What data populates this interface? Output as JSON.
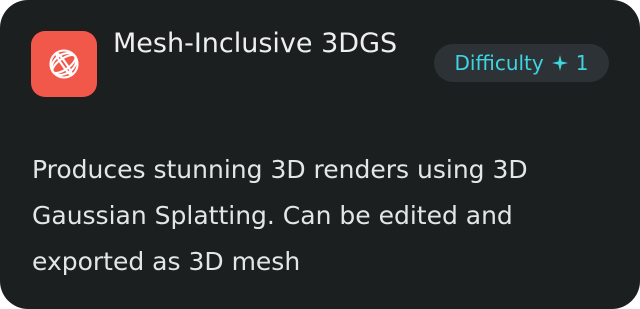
{
  "card": {
    "title": "Mesh-Inclusive 3DGS",
    "logo_icon": "sphere-wireframe-icon",
    "badge": {
      "label": "Difficulty",
      "icon": "sparkle-icon",
      "value": "1"
    },
    "description": "Produces stunning 3D renders using 3D Gaussian Splatting. Can be edited and exported as 3D mesh"
  },
  "colors": {
    "card_background": "#1b1f20",
    "logo_background": "#f1584a",
    "badge_background": "#2c3236",
    "badge_text": "#3ed4e0",
    "text": "#e9ecec"
  }
}
